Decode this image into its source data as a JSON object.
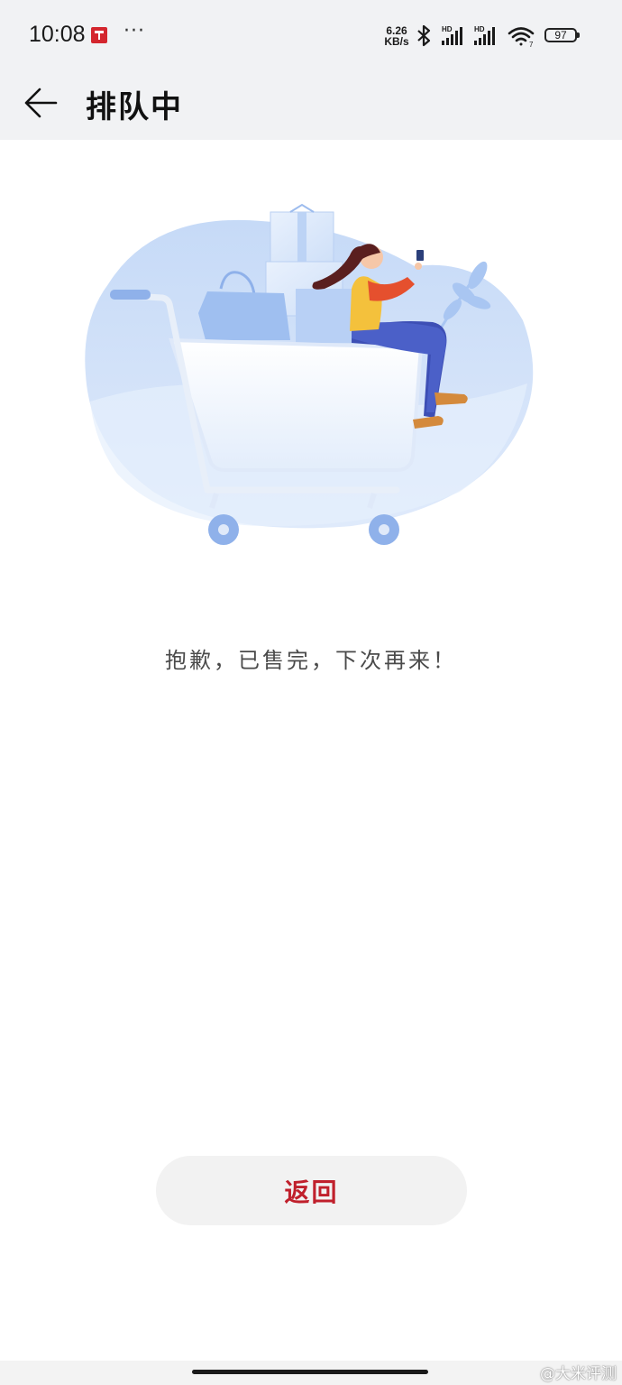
{
  "status_bar": {
    "time": "10:08",
    "more": "···",
    "net_speed_value": "6.26",
    "net_speed_unit": "KB/s",
    "battery": "97",
    "app_icon": "app-notification-icon",
    "icons": [
      "bluetooth-icon",
      "signal-hd-icon",
      "signal-hd-icon",
      "wifi-icon"
    ]
  },
  "header": {
    "title": "排队中",
    "back_icon": "back-arrow-icon"
  },
  "main": {
    "illustration": "shopping-cart-illustration",
    "message": "抱歉，已售完，下次再来！",
    "return_label": "返回"
  },
  "watermark": "@大米评测",
  "colors": {
    "accent": "#c0202c",
    "header_bg": "#f1f2f4",
    "button_bg": "#f2f2f2",
    "illustration_blue": "#7aa6ee"
  }
}
